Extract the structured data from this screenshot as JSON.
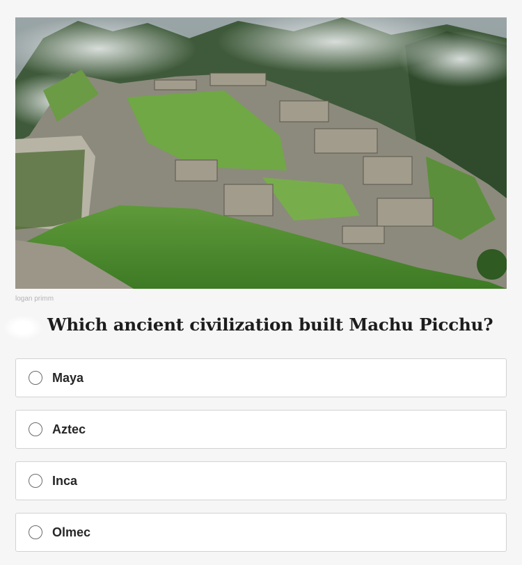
{
  "image": {
    "description_icon": "machu-picchu-photo",
    "credit": "logan primm"
  },
  "question": {
    "text": "Which ancient civilization built Machu Picchu?"
  },
  "options": [
    {
      "label": "Maya"
    },
    {
      "label": "Aztec"
    },
    {
      "label": "Inca"
    },
    {
      "label": "Olmec"
    }
  ]
}
